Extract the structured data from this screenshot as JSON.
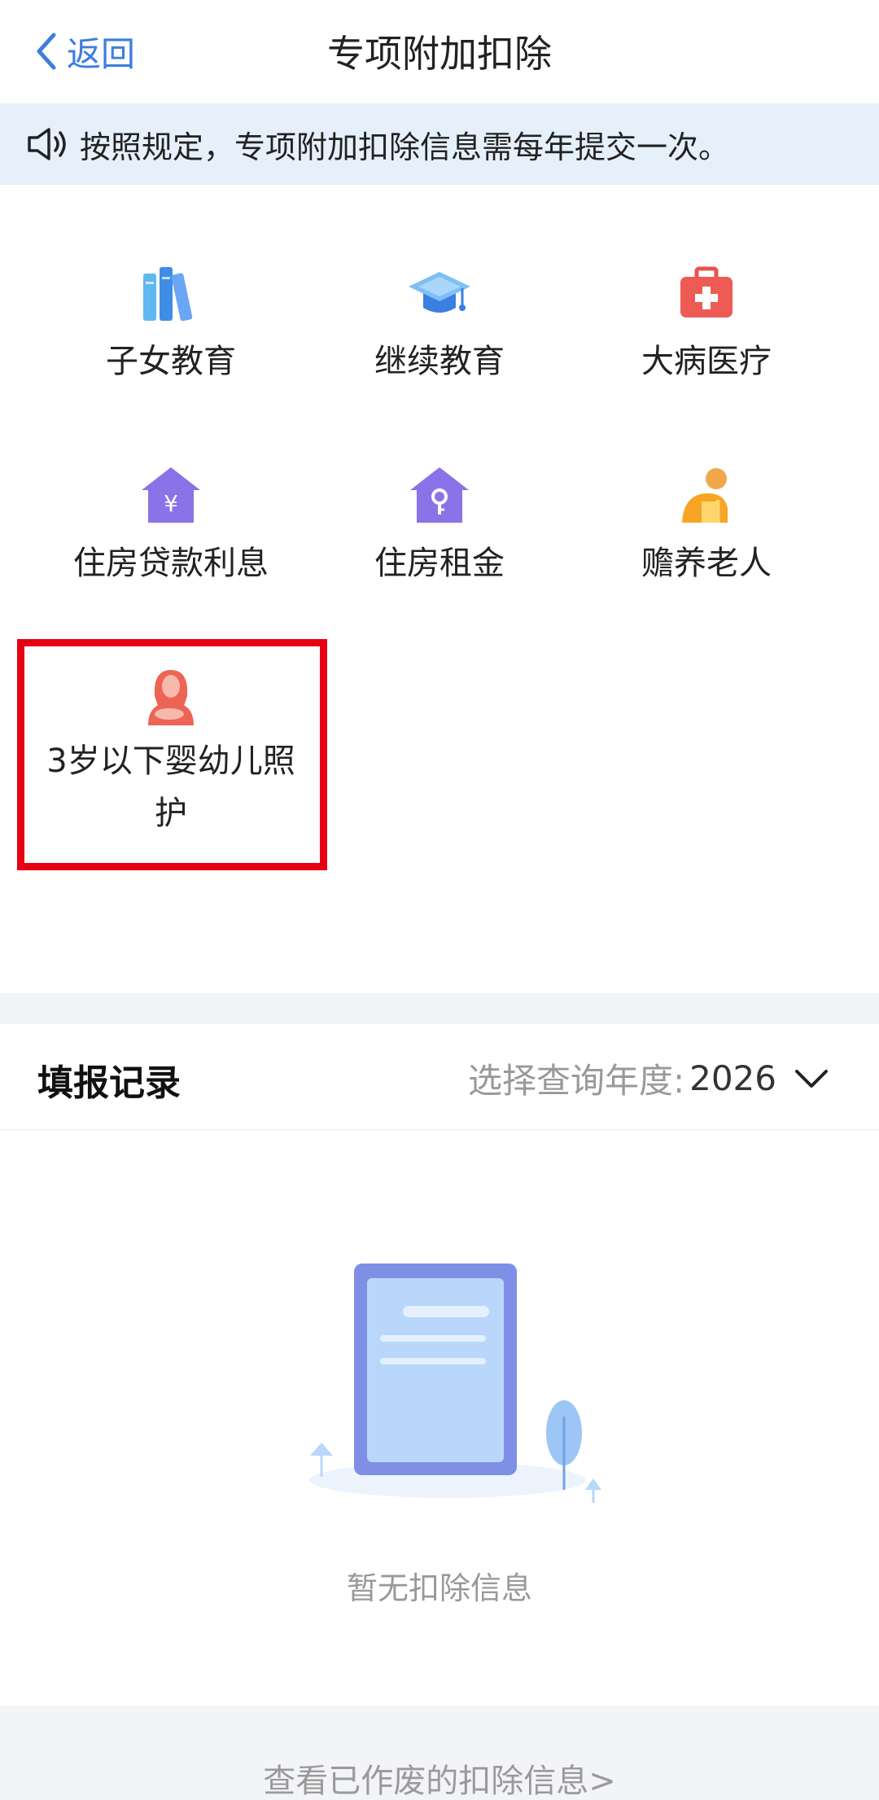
{
  "nav": {
    "back_label": "返回",
    "title": "专项附加扣除"
  },
  "notice": {
    "text": "按照规定，专项附加扣除信息需每年提交一次。"
  },
  "categories": [
    {
      "label": "子女教育",
      "icon": "books-icon"
    },
    {
      "label": "继续教育",
      "icon": "graduation-cap-icon"
    },
    {
      "label": "大病医疗",
      "icon": "medical-kit-icon"
    },
    {
      "label": "住房贷款利息",
      "icon": "house-yuan-icon"
    },
    {
      "label": "住房租金",
      "icon": "house-key-icon"
    },
    {
      "label": "赡养老人",
      "icon": "elderly-person-icon"
    },
    {
      "label": "3岁以下婴幼儿照护",
      "icon": "mother-baby-icon"
    }
  ],
  "records": {
    "title": "填报记录",
    "year_label": "选择查询年度:",
    "year_value": "2026"
  },
  "empty": {
    "text": "暂无扣除信息"
  },
  "footer": {
    "link": "查看已作废的扣除信息>"
  },
  "colors": {
    "accent": "#3d7de0",
    "highlight": "#e60012",
    "notice_bg": "#e6f0fb"
  }
}
